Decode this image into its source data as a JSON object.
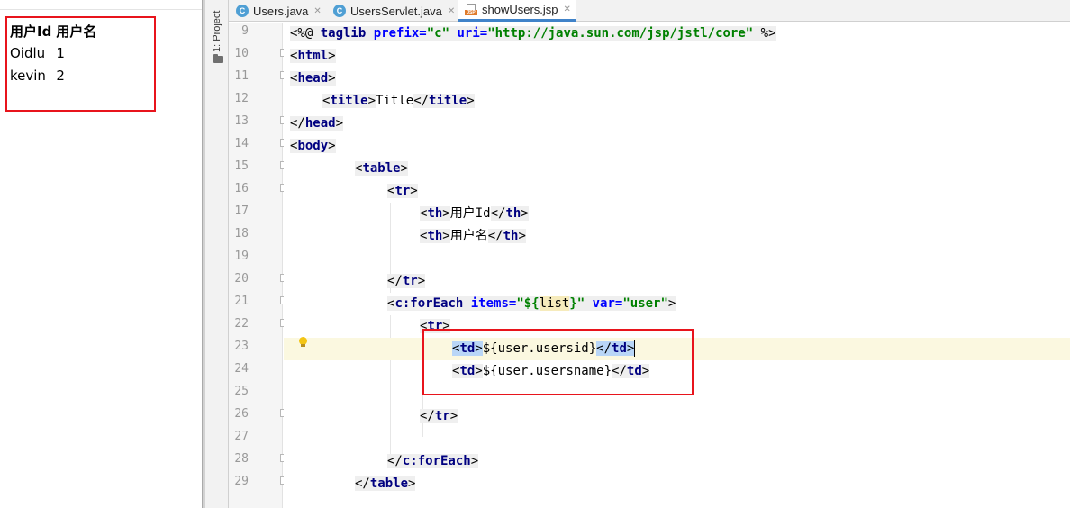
{
  "browser": {
    "headers": [
      "用户Id",
      "用户名"
    ],
    "rows": [
      {
        "id": "Oidlu",
        "name": "1"
      },
      {
        "id": "kevin",
        "name": "2"
      }
    ]
  },
  "sidebar": {
    "project_label": "1: Project"
  },
  "tabs": [
    {
      "label": "Users.java",
      "icon": "class-icon",
      "active": false
    },
    {
      "label": "UsersServlet.java",
      "icon": "class-icon",
      "active": false
    },
    {
      "label": "showUsers.jsp",
      "icon": "jsp-file-icon",
      "active": true
    }
  ],
  "editor": {
    "line_numbers": [
      "9",
      "10",
      "11",
      "12",
      "13",
      "14",
      "15",
      "16",
      "17",
      "18",
      "19",
      "20",
      "21",
      "22",
      "23",
      "24",
      "25",
      "26",
      "27",
      "28",
      "29"
    ],
    "code": {
      "l9_a": "<%@ ",
      "l9_b": "taglib ",
      "l9_c": "prefix=",
      "l9_d": "\"c\"",
      "l9_e": " uri=",
      "l9_f": "\"http://java.sun.com/jsp/jstl/core\"",
      "l9_g": " %>",
      "html_open": "<html>",
      "head_open": "<head>",
      "title_open": "<title>",
      "title_text": "Title",
      "title_close": "</title>",
      "head_close": "</head>",
      "body_open": "<body>",
      "table_open": "<table>",
      "tr_open": "<tr>",
      "th_open": "<th>",
      "th1_text": "用户Id",
      "th_close": "</th>",
      "th2_text": "用户名",
      "tr_close": "</tr>",
      "foreach_a": "<c:forEach ",
      "foreach_b": "items=",
      "foreach_c": "\"${",
      "foreach_d": "list",
      "foreach_e": "}\"",
      "foreach_f": " var=",
      "foreach_g": "\"user\"",
      "foreach_h": ">",
      "tr2_open": "<tr>",
      "td_open": "<td>",
      "td1_expr": "${user.usersid}",
      "td_close": "</td>",
      "td2_expr": "${user.usersname}",
      "tr2_close": "</tr>",
      "foreach_close": "</c:forEach>",
      "table_close": "</table>"
    }
  }
}
